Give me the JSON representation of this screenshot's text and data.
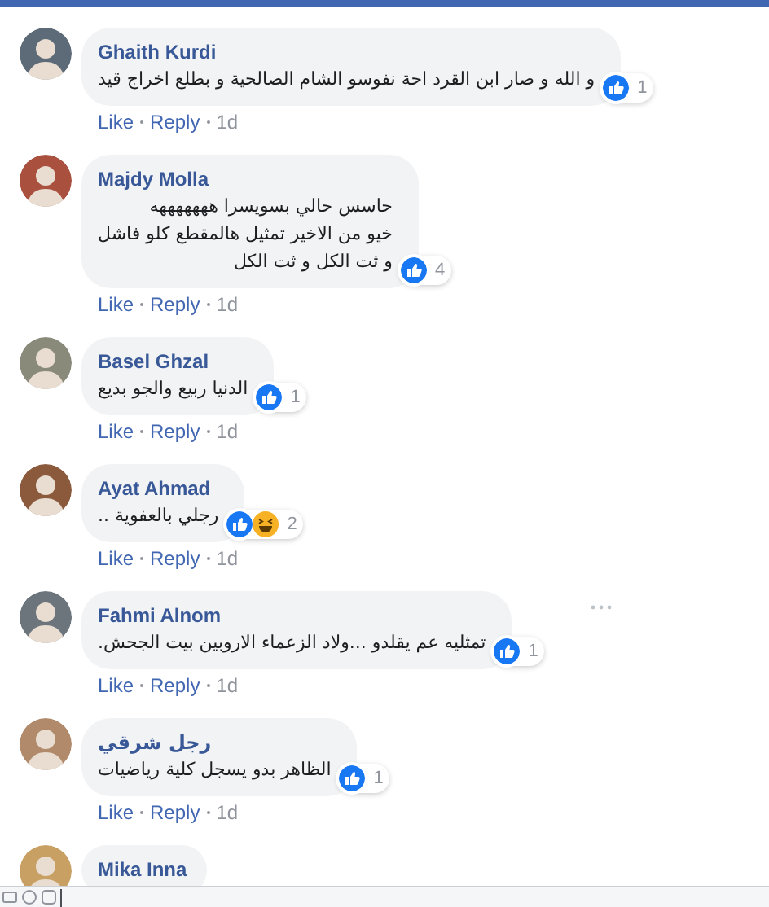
{
  "comments": [
    {
      "author": "Ghaith Kurdi",
      "lines": [
        "و الله و صار ابن القرد احة نفوسو الشام الصالحية و بطلع اخراج قيد"
      ],
      "reactions": [
        {
          "kind": "like"
        }
      ],
      "reaction_count": "1",
      "options_shown": false,
      "like_label": "Like",
      "reply_label": "Reply",
      "time": "1d"
    },
    {
      "author": "Majdy Molla",
      "lines": [
        "حاسس حالي بسويسرا هههههههه",
        "خيو من الاخير تمثيل هالمقطع كلو فاشل",
        "و ثت الكل و ثت الكل"
      ],
      "reactions": [
        {
          "kind": "like"
        }
      ],
      "reaction_count": "4",
      "options_shown": false,
      "like_label": "Like",
      "reply_label": "Reply",
      "time": "1d"
    },
    {
      "author": "Basel Ghzal",
      "lines": [
        "الدنيا ربيع والجو بديع"
      ],
      "reactions": [
        {
          "kind": "like"
        }
      ],
      "reaction_count": "1",
      "options_shown": false,
      "like_label": "Like",
      "reply_label": "Reply",
      "time": "1d"
    },
    {
      "author": "Ayat Ahmad",
      "lines": [
        "رجلي بالعفوية .."
      ],
      "reactions": [
        {
          "kind": "like"
        },
        {
          "kind": "haha"
        }
      ],
      "reaction_count": "2",
      "options_shown": false,
      "like_label": "Like",
      "reply_label": "Reply",
      "time": "1d"
    },
    {
      "author": "Fahmi Alnom",
      "lines": [
        "تمثليه عم يقلدو ...ولاد الزعماء الاروبين بيت الجحش."
      ],
      "reactions": [
        {
          "kind": "like"
        }
      ],
      "reaction_count": "1",
      "options_shown": true,
      "like_label": "Like",
      "reply_label": "Reply",
      "time": "1d"
    },
    {
      "author": "رجل شرقي",
      "lines": [
        "الظاهر بدو يسجل كلية رياضيات"
      ],
      "reactions": [
        {
          "kind": "like"
        }
      ],
      "reaction_count": "1",
      "options_shown": false,
      "like_label": "Like",
      "reply_label": "Reply",
      "time": "1d"
    },
    {
      "author": "Mika Inna",
      "options_shown": false
    }
  ]
}
